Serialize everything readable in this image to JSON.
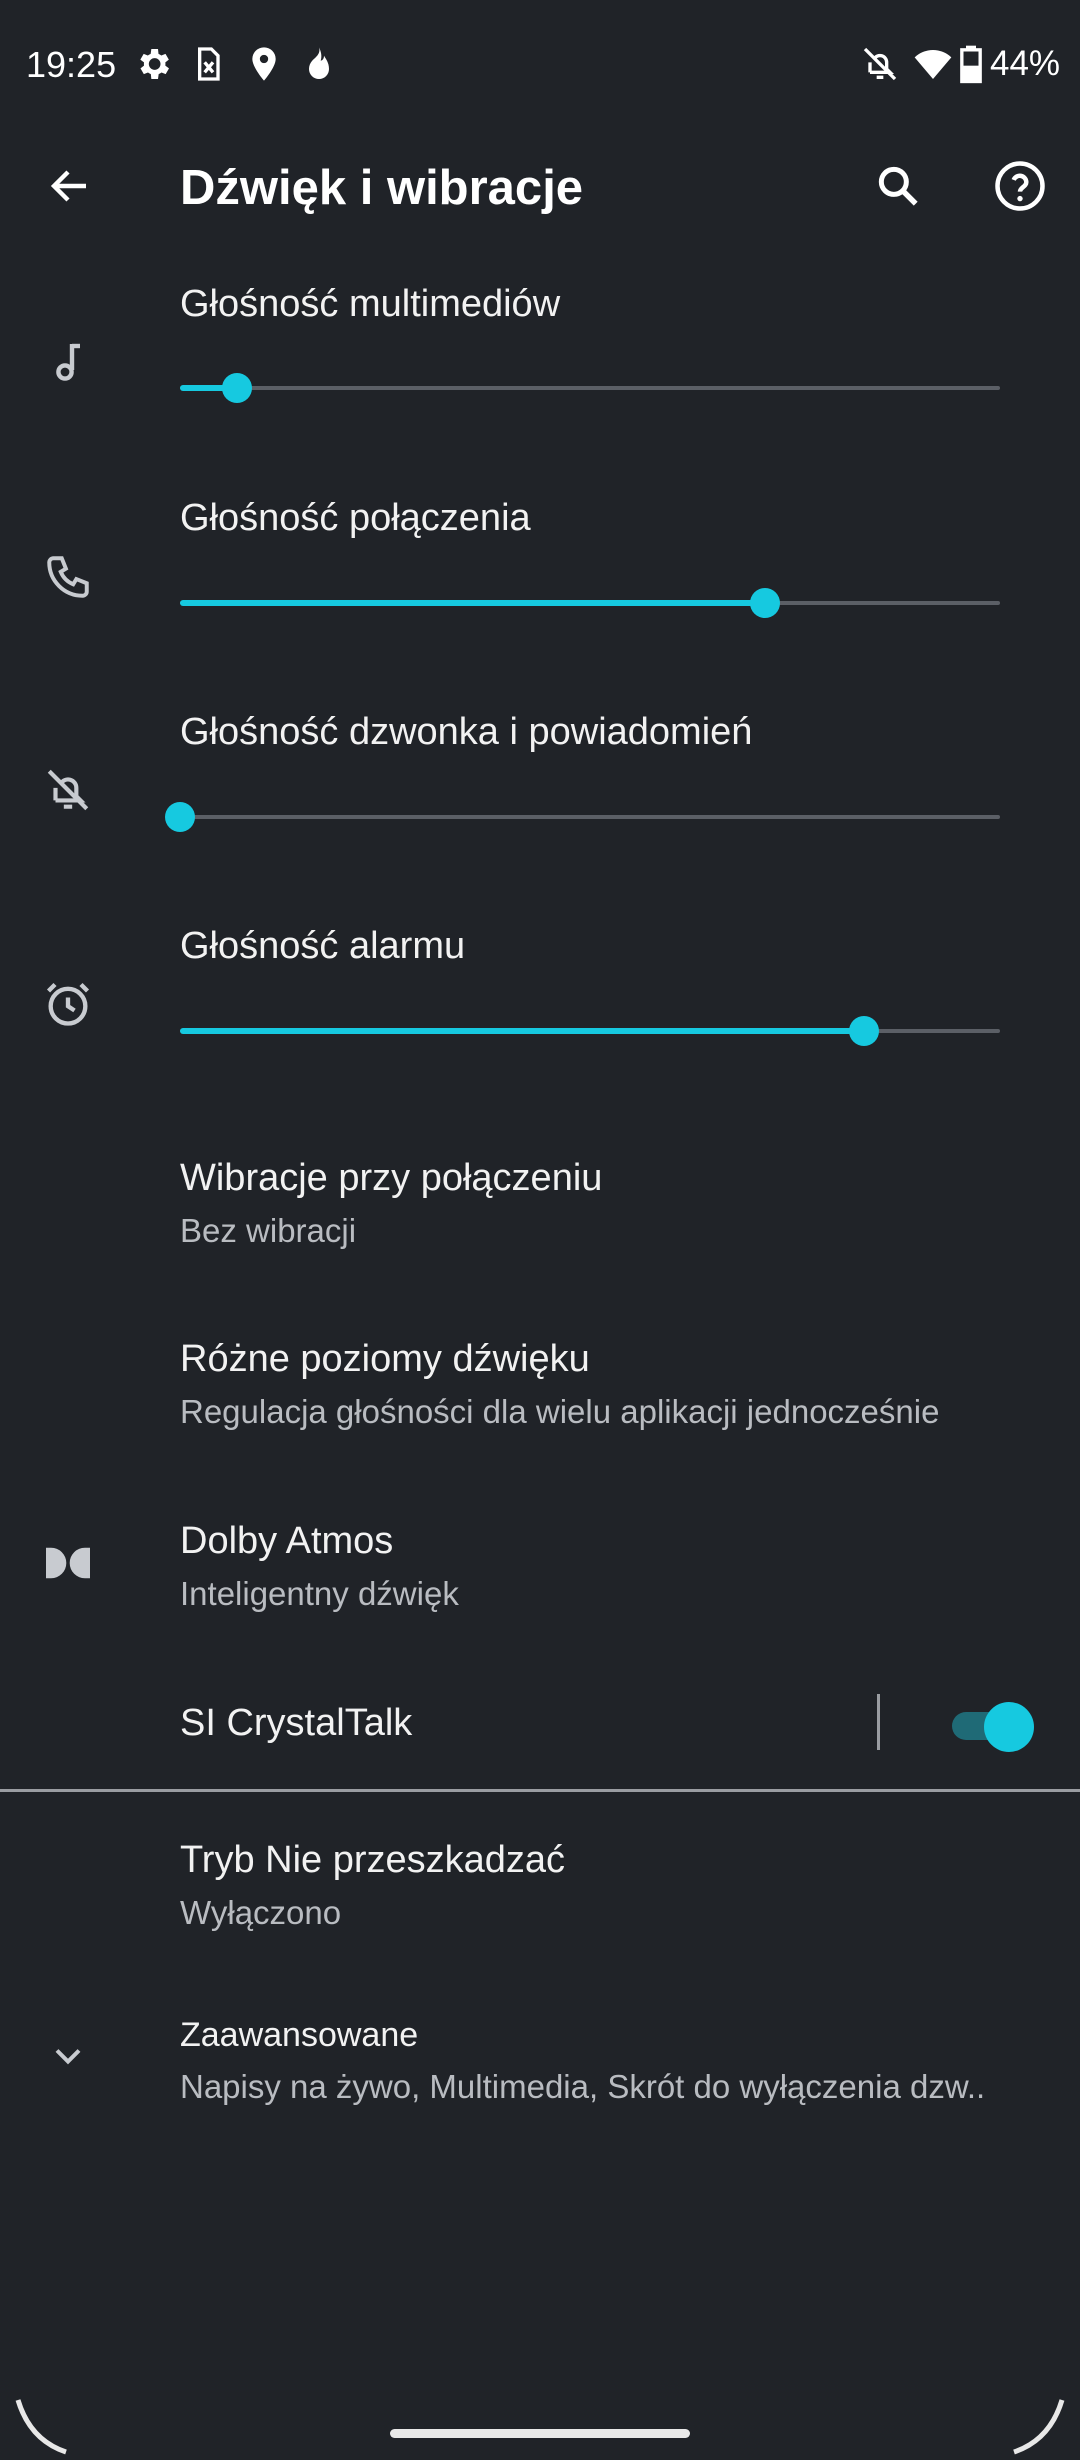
{
  "status_bar": {
    "time": "19:25",
    "battery": "44%",
    "left_icons": [
      "gear-icon",
      "sim-icon",
      "location-icon",
      "fire-icon"
    ],
    "right_icons": [
      "bell-off-icon",
      "wifi-icon",
      "battery-icon"
    ]
  },
  "app_bar": {
    "back_icon": "arrow-left-icon",
    "title": "Dźwięk i wibracje",
    "search_icon": "search-icon",
    "help_icon": "help-icon"
  },
  "volumes": [
    {
      "label": "Głośność multimediów",
      "icon": "music-note-icon",
      "level": 0.07
    },
    {
      "label": "Głośność połączenia",
      "icon": "phone-icon",
      "level": 0.714
    },
    {
      "label": "Głośność dzwonka i powiadomień",
      "icon": "bell-off-icon",
      "level": 0.0
    },
    {
      "label": "Głośność alarmu",
      "icon": "alarm-clock-icon",
      "level": 0.834
    }
  ],
  "settings": {
    "vibration": {
      "label": "Wibracje przy połączeniu",
      "sub": "Bez wibracji"
    },
    "multi_levels": {
      "label": "Różne poziomy dźwięku",
      "sub": "Regulacja głośności dla wielu aplikacji jednocześnie"
    },
    "dolby": {
      "label": "Dolby Atmos",
      "sub": "Inteligentny dźwięk",
      "icon": "dolby-icon"
    },
    "crystaltalk": {
      "label": "SI CrystalTalk",
      "enabled": true
    },
    "dnd": {
      "label": "Tryb Nie przeszkadzać",
      "sub": "Wyłączono"
    },
    "advanced": {
      "label": "Zaawansowane",
      "sub": "Napisy na żywo, Multimedia, Skrót do wyłączenia dzw..",
      "icon": "chevron-down-icon"
    }
  },
  "colors": {
    "background": "#202328",
    "accent": "#16c9e0",
    "secondary_text": "#b9bcc1"
  }
}
